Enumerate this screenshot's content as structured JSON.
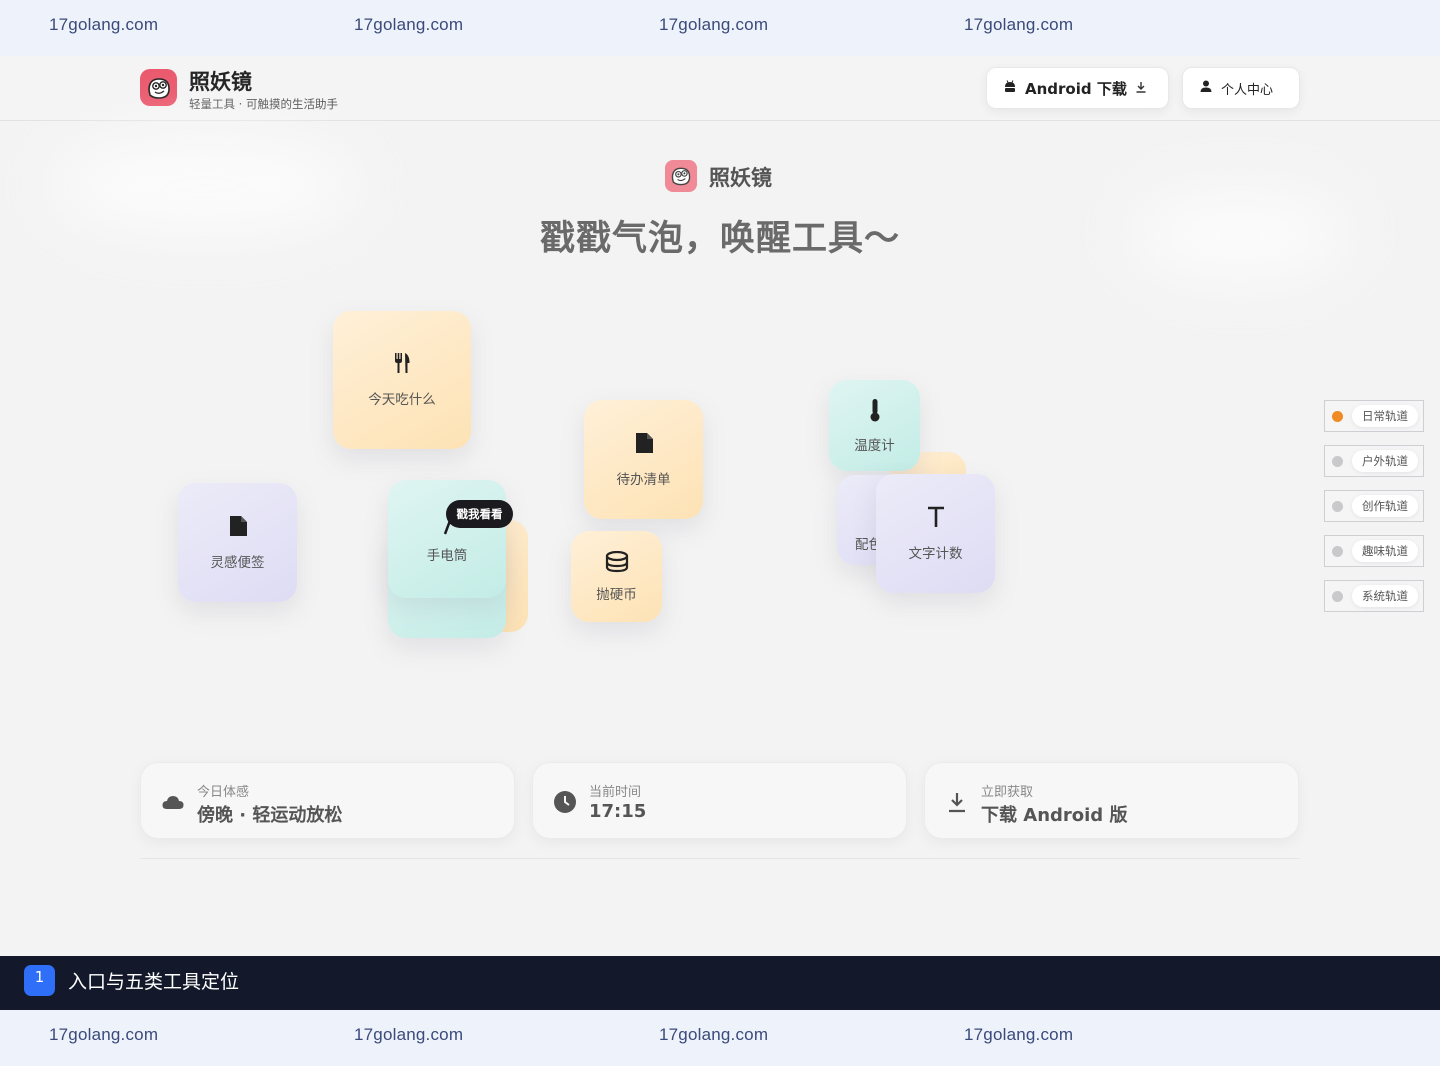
{
  "watermark": [
    "17golang.com",
    "17golang.com",
    "17golang.com",
    "17golang.com"
  ],
  "header": {
    "brand_name": "照妖镜",
    "brand_tagline": "轻量工具 · 可触摸的生活助手",
    "android_button": "Android 下载",
    "user_button": "个人中心"
  },
  "hero": {
    "logo_name": "照妖镜",
    "slogan": "戳戳气泡，唤醒工具～"
  },
  "tools": [
    {
      "label": "今天吃什么",
      "icon": "fork-knife-icon"
    },
    {
      "label": "灵感便签",
      "icon": "note-icon"
    },
    {
      "label": "手电筒",
      "icon": "flashlight-icon"
    },
    {
      "label": "待办清单",
      "icon": "file-icon"
    },
    {
      "label": "抛硬币",
      "icon": "coin-stack-icon"
    },
    {
      "label": "温度计",
      "icon": "thermometer-icon"
    },
    {
      "label": "配色",
      "icon": "palette-icon"
    },
    {
      "label": "文字计数",
      "icon": "text-icon"
    }
  ],
  "tooltip": "戳我看看",
  "tracks": [
    {
      "label": "日常轨道",
      "active": true
    },
    {
      "label": "户外轨道",
      "active": false
    },
    {
      "label": "创作轨道",
      "active": false
    },
    {
      "label": "趣味轨道",
      "active": false
    },
    {
      "label": "系统轨道",
      "active": false
    }
  ],
  "cards": {
    "mood": {
      "sub": "今日体感",
      "value": "傍晚 · 轻运动放松",
      "icon": "cloud-icon"
    },
    "time": {
      "sub": "当前时间",
      "value": "17:15",
      "icon": "clock-icon"
    },
    "download": {
      "sub": "立即获取",
      "value": "下载 Android 版",
      "icon": "download-icon"
    }
  },
  "step": {
    "number": "1",
    "title": "入口与五类工具定位"
  },
  "colors": {
    "accent": "#2f6ef6",
    "track_active": "#f08a24",
    "logo": "#ea5a6e"
  }
}
